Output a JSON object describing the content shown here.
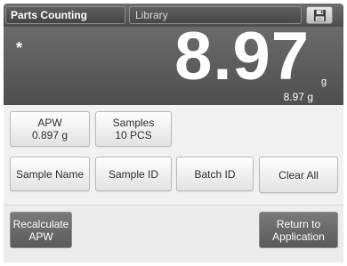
{
  "header": {
    "app_title": "Parts Counting",
    "library_label": "Library",
    "save_icon": "floppy-disk-icon"
  },
  "display": {
    "stable_indicator": "*",
    "main_value": "8.97",
    "main_unit": "g",
    "secondary_value": "8.97 g"
  },
  "info_buttons": {
    "apw_label": "APW",
    "apw_value": "0.897 g",
    "samples_label": "Samples",
    "samples_value": "10 PCS"
  },
  "action_buttons": {
    "sample_name": "Sample Name",
    "sample_id": "Sample ID",
    "batch_id": "Batch ID",
    "clear_all": "Clear All"
  },
  "footer_buttons": {
    "recalculate_line1": "Recalculate",
    "recalculate_line2": "APW",
    "return_line1": "Return to",
    "return_line2": "Application"
  }
}
